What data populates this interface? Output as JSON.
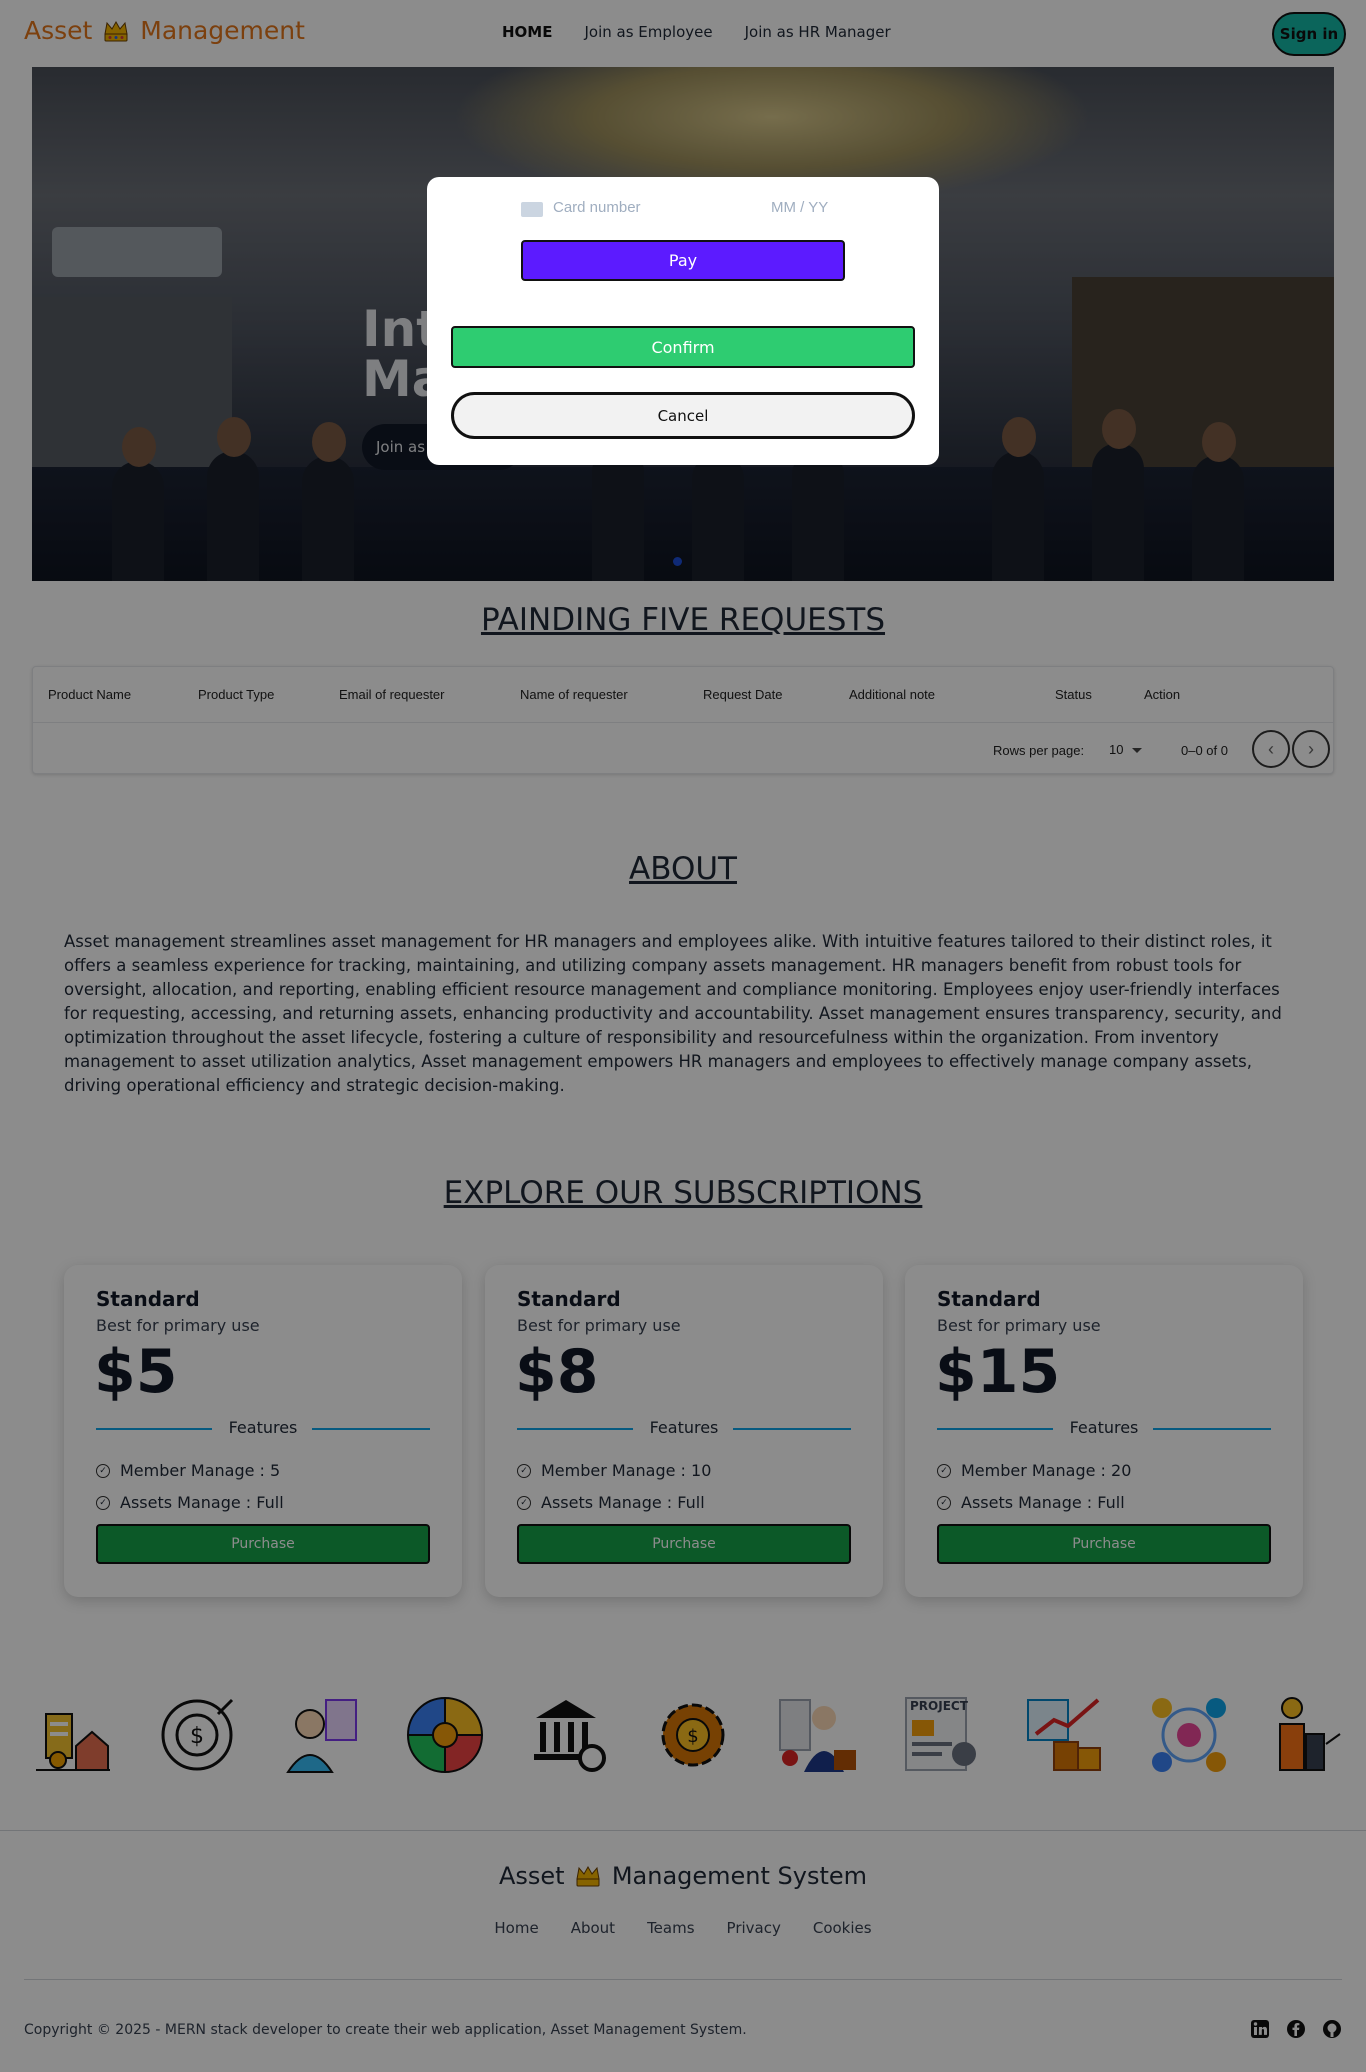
{
  "nav": {
    "logo_left": "Asset",
    "logo_right": "Management",
    "links": [
      "HOME",
      "Join as Employee",
      "Join as HR Manager"
    ],
    "signin": "Sign in"
  },
  "hero": {
    "title_line1": "Int",
    "title_line2": "Ma",
    "button": "Join as"
  },
  "pending": {
    "title": "PAINDING FIVE REQUESTS",
    "columns": [
      "Product Name",
      "Product Type",
      "Email of requester",
      "Name of requester",
      "Request Date",
      "Additional note",
      "Status",
      "Action"
    ],
    "rows_per_page_label": "Rows per page:",
    "rows_per_page": "10",
    "range": "0–0 of 0"
  },
  "about": {
    "title": "ABOUT",
    "text": "Asset management streamlines asset management for HR managers and employees alike. With intuitive features tailored to their distinct roles, it offers a seamless experience for tracking, maintaining, and utilizing company assets management. HR managers benefit from robust tools for oversight, allocation, and reporting, enabling efficient resource management and compliance monitoring. Employees enjoy user-friendly interfaces for requesting, accessing, and returning assets, enhancing productivity and accountability. Asset management ensures transparency, security, and optimization throughout the asset lifecycle, fostering a culture of responsibility and resourcefulness within the organization. From inventory management to asset utilization analytics, Asset management empowers HR managers and employees to effectively manage company assets, driving operational efficiency and strategic decision-making."
  },
  "subscriptions": {
    "title": "EXPLORE OUR SUBSCRIPTIONS",
    "plans": [
      {
        "name": "Standard",
        "subtitle": "Best for primary use",
        "price": "$5",
        "features_label": "Features",
        "member": "Member Manage : 5",
        "assets": "Assets Manage : Full",
        "button": "Purchase"
      },
      {
        "name": "Standard",
        "subtitle": "Best for primary use",
        "price": "$8",
        "features_label": "Features",
        "member": "Member Manage : 10",
        "assets": "Assets Manage : Full",
        "button": "Purchase"
      },
      {
        "name": "Standard",
        "subtitle": "Best for primary use",
        "price": "$15",
        "features_label": "Features",
        "member": "Member Manage : 20",
        "assets": "Assets Manage : Full",
        "button": "Purchase"
      }
    ]
  },
  "icon_strip": [
    "building-coins-icon",
    "dollar-target-icon",
    "employee-document-icon",
    "pie-chart-dollar-icon",
    "bank-gear-icon",
    "gear-dollar-icon",
    "manager-checklist-icon",
    "project-document-icon",
    "growth-boxes-icon",
    "network-people-icon",
    "city-clock-icon"
  ],
  "icon_strip_project_label": "PROJECT",
  "footer": {
    "title_left": "Asset",
    "title_right": "Management System",
    "links": [
      "Home",
      "About",
      "Teams",
      "Privacy",
      "Cookies"
    ],
    "copyright": "Copyright © 2025 - MERN stack developer to create their web application, Asset Management System.",
    "social": [
      "linkedin-icon",
      "facebook-icon",
      "github-icon"
    ]
  },
  "modal": {
    "card_placeholder": "Card number",
    "expiry_placeholder": "MM / YY",
    "pay": "Pay",
    "confirm": "Confirm",
    "cancel": "Cancel"
  },
  "colors": {
    "brand": "#e2761b",
    "signin": "#14b8a6",
    "pay": "#5c1bff",
    "confirm": "#2ecc71",
    "purchase": "#16a34a",
    "feature_line": "#0ea5e9"
  }
}
